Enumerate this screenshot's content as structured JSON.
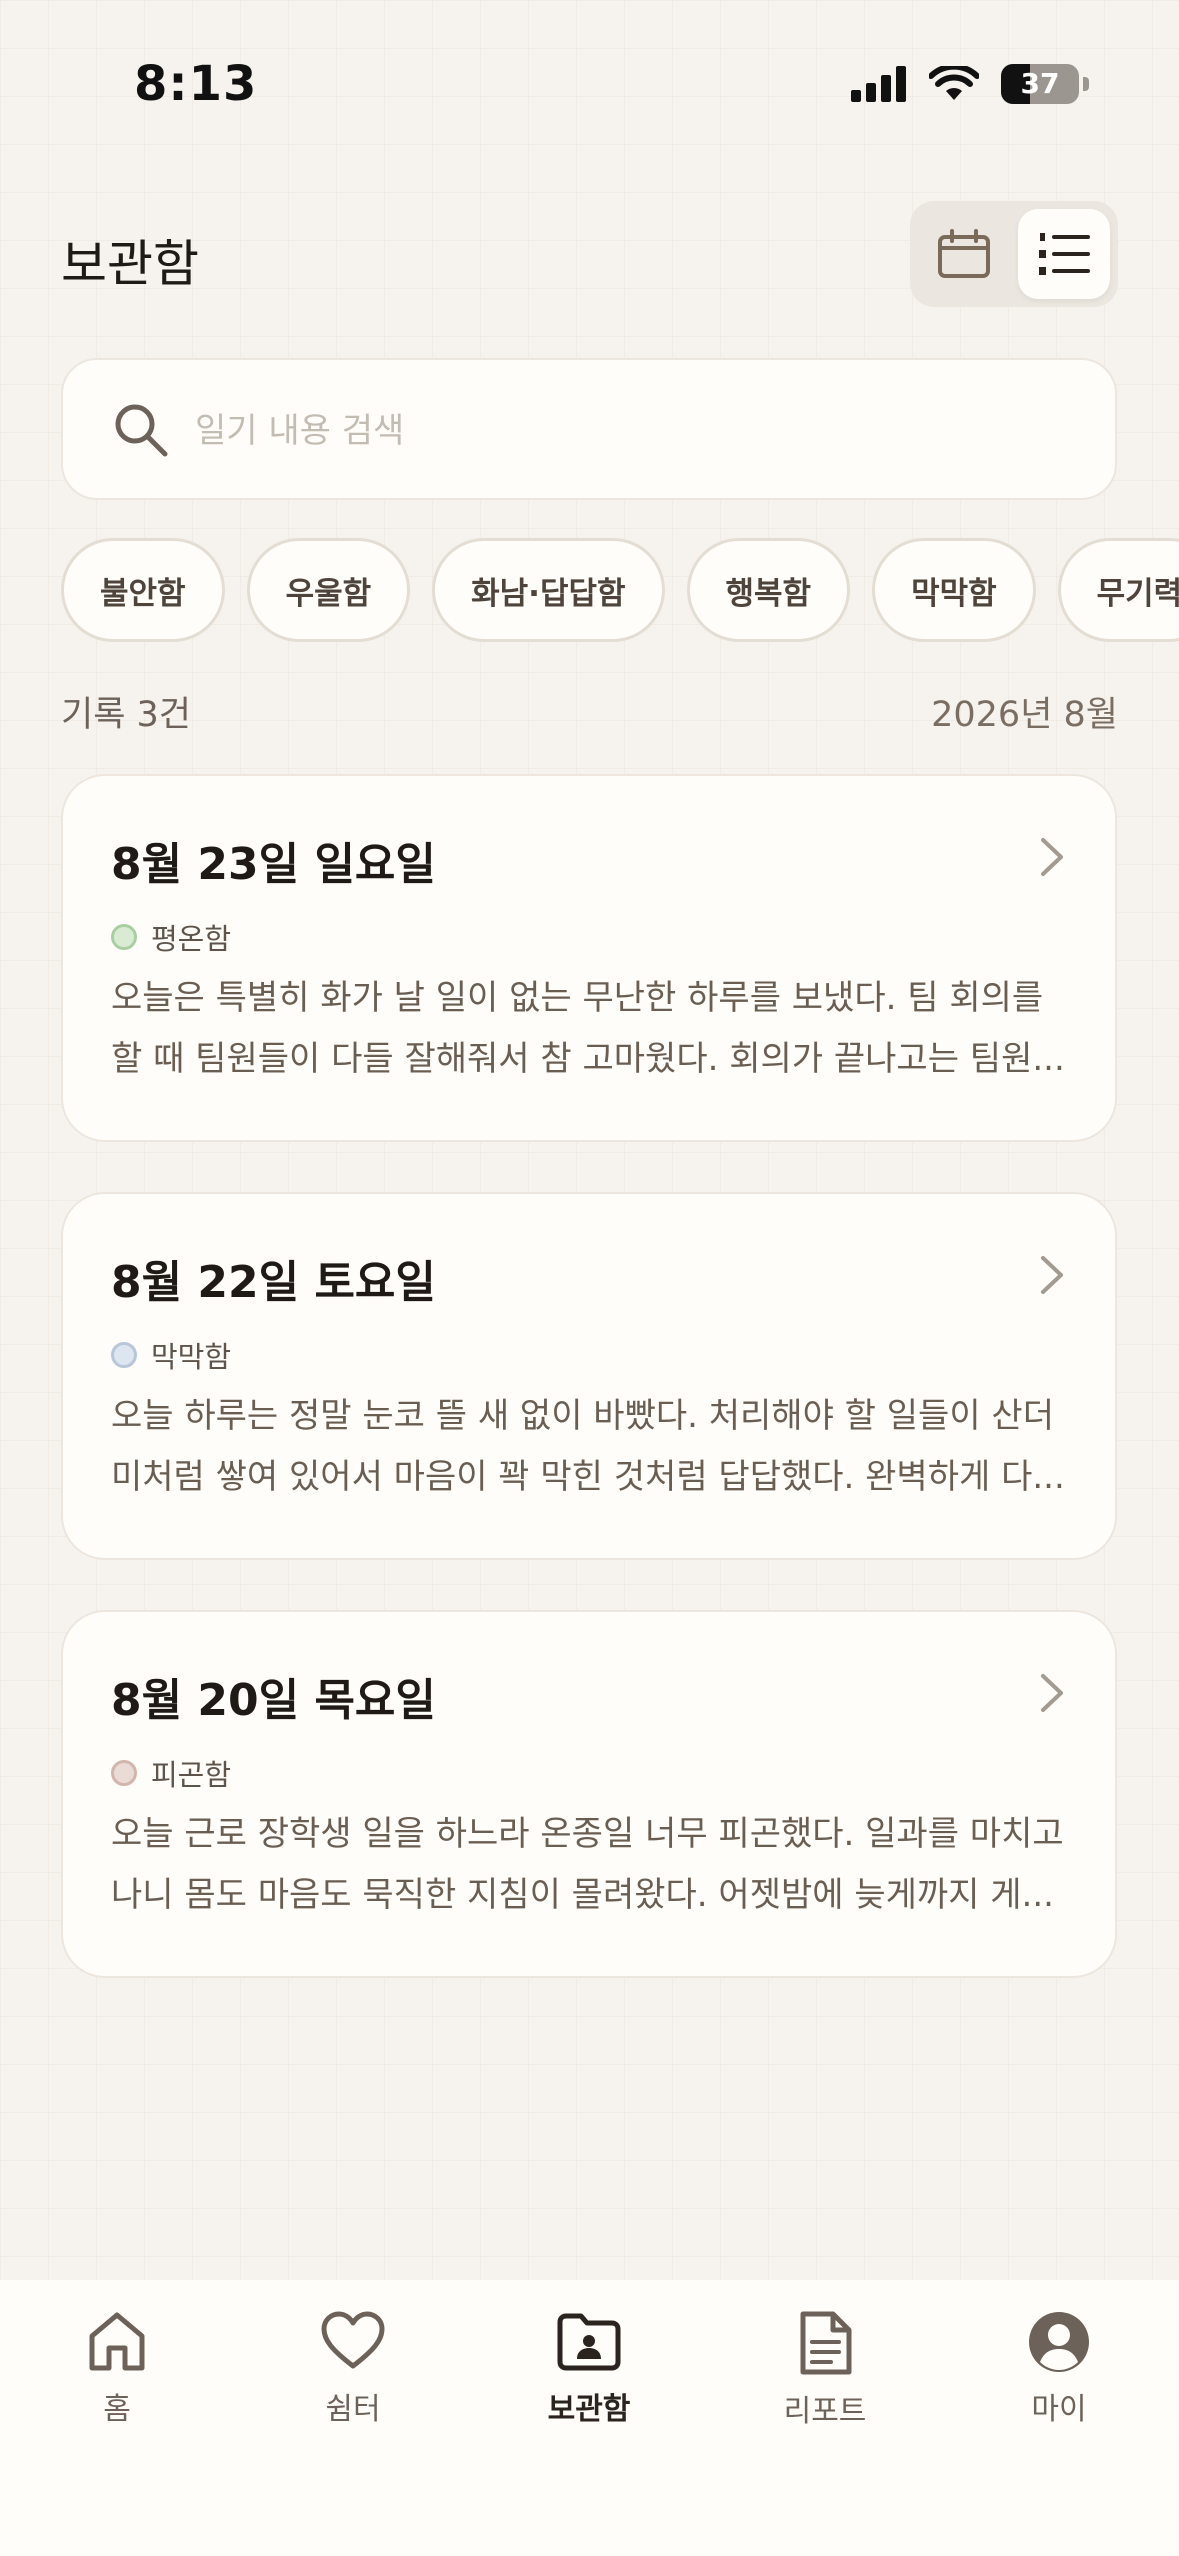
{
  "status_bar": {
    "time": "8:13",
    "battery": "37",
    "battery_level": 0.37
  },
  "header": {
    "title": "보관함"
  },
  "search": {
    "placeholder": "일기 내용 검색"
  },
  "chips": [
    "불안함",
    "우울함",
    "화남·답답함",
    "행복함",
    "막막함",
    "무기력"
  ],
  "summary": {
    "count": "기록 3건",
    "month": "2026년 8월"
  },
  "entries": [
    {
      "date": "8월 23일 일요일",
      "emotion": "평온함",
      "dot_border": "#a9cfa0",
      "dot_fill": "#d9ebd3",
      "line1": "오늘은 특별히 화가 날 일이 없는 무난한 하루를 보냈다. 팀 회의를",
      "line2": "할 때 팀원들이 다들 잘해줘서 참 고마웠다. 회의가 끝나고는 팀원..."
    },
    {
      "date": "8월 22일 토요일",
      "emotion": "막막함",
      "dot_border": "#b7c6d8",
      "dot_fill": "#dde6f0",
      "line1": "오늘 하루는 정말 눈코 뜰 새 없이 바빴다. 처리해야 할 일들이 산더",
      "line2": "미처럼 쌓여 있어서 마음이 꽉 막힌 것처럼 답답했다. 완벽하게 다..."
    },
    {
      "date": "8월 20일 목요일",
      "emotion": "피곤함",
      "dot_border": "#d2b5ad",
      "dot_fill": "#eadbd6",
      "line1": "오늘 근로 장학생 일을 하느라 온종일 너무 피곤했다. 일과를 마치고",
      "line2": "나니 몸도 마음도 묵직한 지침이 몰려왔다. 어젯밤에 늦게까지 게..."
    }
  ],
  "nav": [
    {
      "label": "홈",
      "icon": "home-icon"
    },
    {
      "label": "쉼터",
      "icon": "heart-icon"
    },
    {
      "label": "보관함",
      "icon": "folder-icon"
    },
    {
      "label": "리포트",
      "icon": "report-icon"
    },
    {
      "label": "마이",
      "icon": "profile-icon"
    }
  ],
  "colors": {
    "accent": "#4a3f35",
    "background": "#f6f3ee",
    "card": "#fffdf9"
  }
}
